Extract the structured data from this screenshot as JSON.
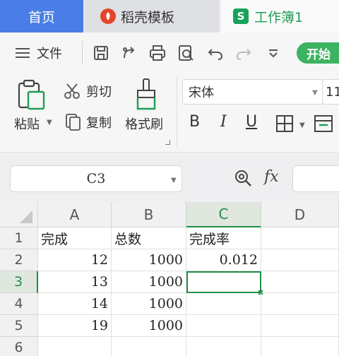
{
  "tabs": {
    "home": "首页",
    "template": "稻壳模板",
    "workbook": "工作簿1",
    "workbook_icon_letter": "S"
  },
  "quickbar": {
    "file": "文件",
    "start": "开始",
    "icons": [
      "save-icon",
      "export-icon",
      "print-icon",
      "print-preview-icon",
      "undo-icon",
      "redo-icon",
      "more-dropdown-icon"
    ]
  },
  "ribbon": {
    "paste": "粘贴",
    "cut": "剪切",
    "copy": "复制",
    "format_painter": "格式刷",
    "font_name": "宋体",
    "font_size": "11",
    "bold": "B",
    "italic": "I",
    "underline": "U"
  },
  "formula_bar": {
    "name_box": "C3",
    "fx": "fx",
    "formula": ""
  },
  "sheet": {
    "columns": [
      "A",
      "B",
      "C",
      "D"
    ],
    "rows": [
      "1",
      "2",
      "3",
      "4",
      "5",
      "6"
    ],
    "active_cell": "C3",
    "cells": [
      [
        "完成",
        "总数",
        "完成率",
        ""
      ],
      [
        "12",
        "1000",
        "0.012",
        ""
      ],
      [
        "13",
        "1000",
        "",
        ""
      ],
      [
        "14",
        "1000",
        "",
        ""
      ],
      [
        "19",
        "1000",
        "",
        ""
      ],
      [
        "",
        "",
        "",
        ""
      ]
    ]
  },
  "colors": {
    "home_tab": "#4a7ee6",
    "accent_green": "#1f8f48",
    "start_button": "#3cb360"
  }
}
